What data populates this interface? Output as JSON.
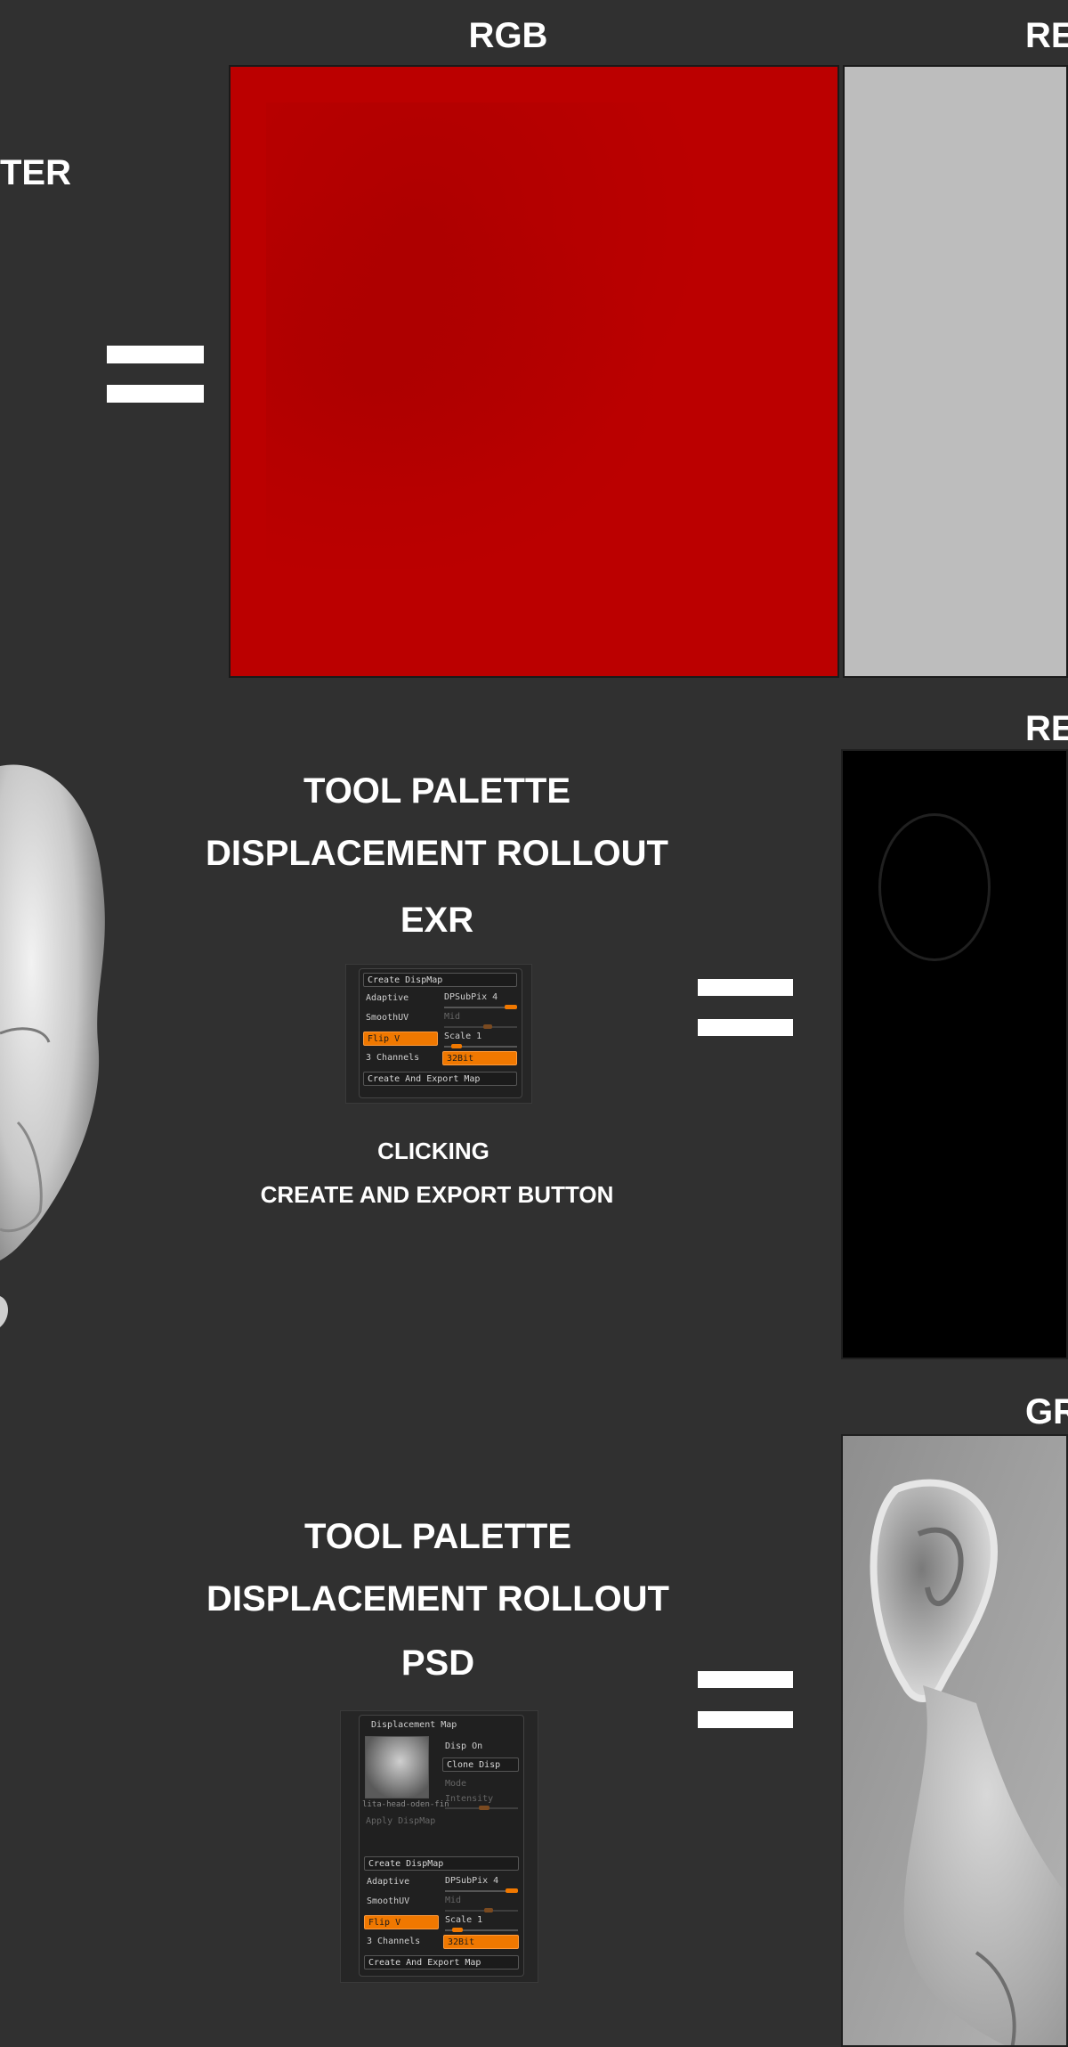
{
  "headings": {
    "rgb": "RGB",
    "red_top": "RE",
    "ter": "TER",
    "red_mid": "RE",
    "gr": "GR"
  },
  "exr_section": {
    "line1": "TOOL PALETTE",
    "line2": "DISPLACEMENT ROLLOUT",
    "line3": "EXR",
    "caption1": "CLICKING",
    "caption2": "CREATE AND EXPORT BUTTON"
  },
  "psd_section": {
    "line1": "TOOL PALETTE",
    "line2": "DISPLACEMENT ROLLOUT",
    "line3": "PSD"
  },
  "exr_panel": {
    "create_dispmap": "Create DispMap",
    "adaptive": "Adaptive",
    "dpsubpix": "DPSubPix 4",
    "smoothuv": "SmoothUV",
    "mid": "Mid",
    "flip_v": "Flip V",
    "scale": "Scale 1",
    "channels": "3 Channels",
    "bit": "32Bit",
    "create_export": "Create And Export Map"
  },
  "psd_panel": {
    "title": "Displacement Map",
    "disp_on": "Disp On",
    "clone_disp": "Clone Disp",
    "mode": "Mode",
    "intensity": "Intensity",
    "thumb_caption": "lita-head-oden-fin",
    "apply_dispmap": "Apply DispMap",
    "create_dispmap": "Create DispMap",
    "adaptive": "Adaptive",
    "dpsubpix": "DPSubPix 4",
    "smoothuv": "SmoothUV",
    "mid": "Mid",
    "flip_v": "Flip V",
    "scale": "Scale 1",
    "channels": "3 Channels",
    "bit": "32Bit",
    "create_export": "Create And Export Map"
  },
  "colors": {
    "background": "#303030",
    "red_map": "#bb0000",
    "grey_map": "#bdbdbd",
    "accent_orange": "#f07800"
  }
}
